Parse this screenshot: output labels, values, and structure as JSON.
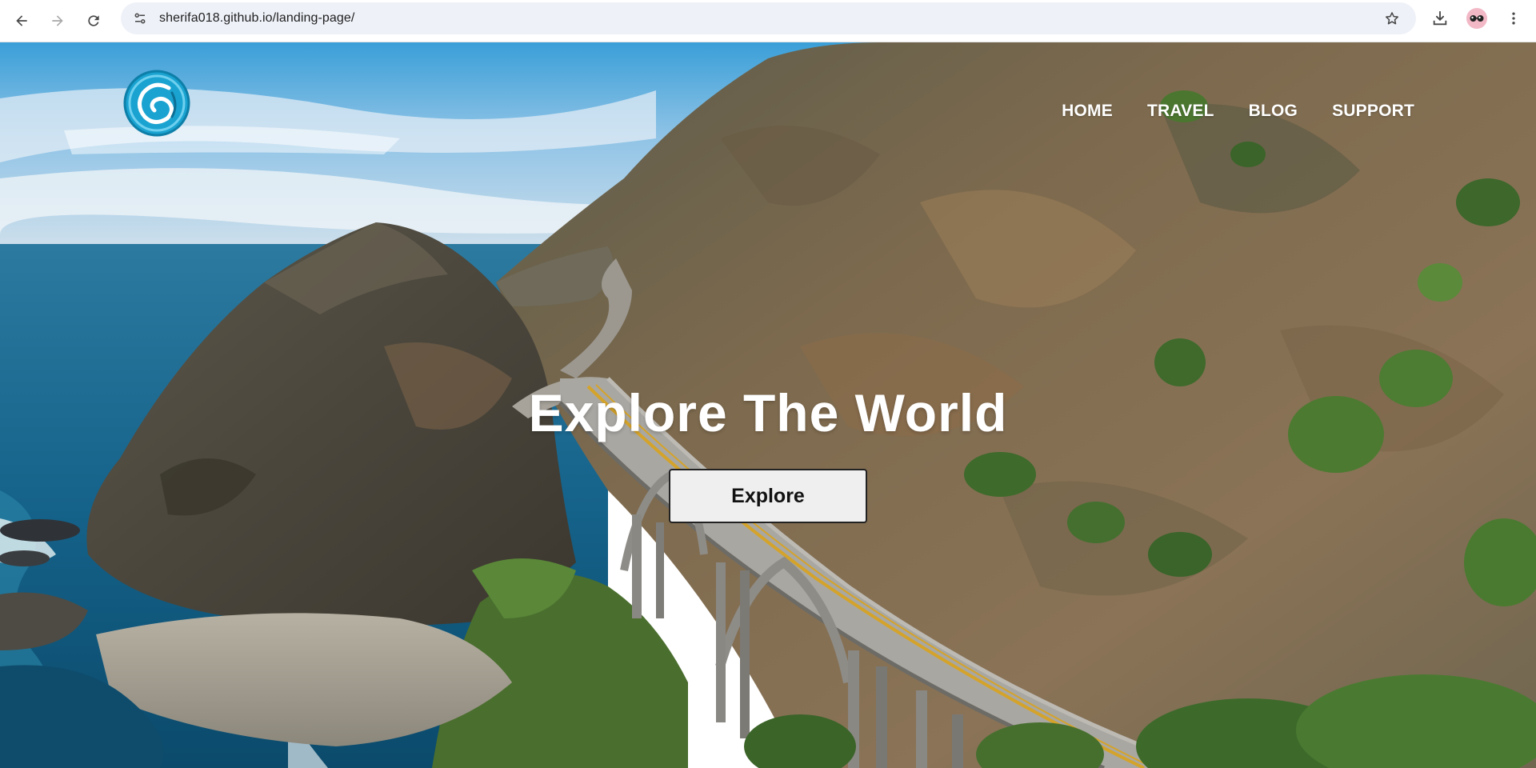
{
  "browser": {
    "url": "sherifa018.github.io/landing-page/",
    "icons": {
      "back": "arrow-left-icon",
      "forward": "arrow-right-icon",
      "reload": "reload-icon",
      "site_info": "tune-icon",
      "bookmark": "star-icon",
      "downloads": "download-icon",
      "profile": "avatar-icon",
      "menu": "kebab-menu-icon"
    }
  },
  "page": {
    "logo_icon": "swirl-logo-icon",
    "nav": [
      {
        "label": "HOME"
      },
      {
        "label": "TRAVEL"
      },
      {
        "label": "BLOG"
      },
      {
        "label": "SUPPORT"
      }
    ],
    "hero": {
      "title": "Explore The World",
      "button_label": "Explore"
    }
  },
  "colors": {
    "omnibox_bg": "#eef1f8",
    "logo_accent": "#1aa3d1",
    "nav_text": "#ffffff",
    "button_bg": "#efefef",
    "button_border": "#222222"
  }
}
